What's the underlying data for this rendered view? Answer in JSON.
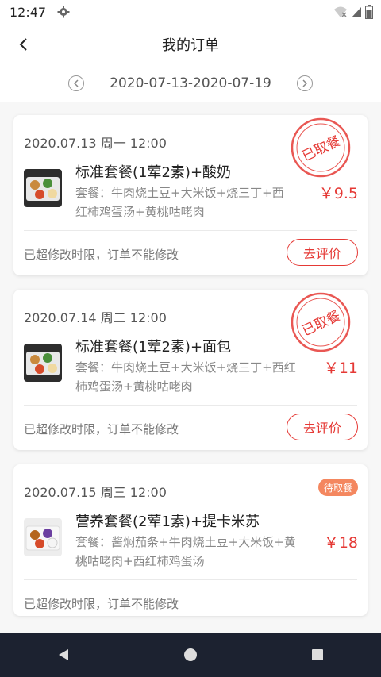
{
  "status_bar": {
    "time": "12:47"
  },
  "header": {
    "title": "我的订单"
  },
  "date_nav": {
    "range": "2020-07-13-2020-07-19"
  },
  "orders": [
    {
      "date": "2020.07.13 周一 12:00",
      "name": "标准套餐(1荤2素)+酸奶",
      "desc_line1": "套餐：牛肉烧土豆+大米饭+烧三丁+西",
      "desc_line2": "红柿鸡蛋汤+黄桃咕咾肉",
      "price": "￥9.5",
      "notice": "已超修改时限，订单不能修改",
      "action": "去评价",
      "stamp_text": "已取餐"
    },
    {
      "date": "2020.07.14 周二 12:00",
      "name": "标准套餐(1荤2素)+面包",
      "desc_line1": "套餐：牛肉烧土豆+大米饭+烧三丁+西红",
      "desc_line2": "柿鸡蛋汤+黄桃咕咾肉",
      "price": "￥11",
      "notice": "已超修改时限，订单不能修改",
      "action": "去评价",
      "stamp_text": "已取餐"
    },
    {
      "date": "2020.07.15 周三 12:00",
      "name": "营养套餐(2荤1素)+提卡米苏",
      "desc_line1": "套餐：酱焖茄条+牛肉烧土豆+大米饭+黄",
      "desc_line2": "桃咕咾肉+西红柿鸡蛋汤",
      "price": "￥18",
      "notice": "已超修改时限，订单不能修改",
      "badge": "待取餐"
    }
  ],
  "colors": {
    "accent": "#e53935",
    "badge": "#f4875f",
    "navbar": "#1c2230"
  }
}
